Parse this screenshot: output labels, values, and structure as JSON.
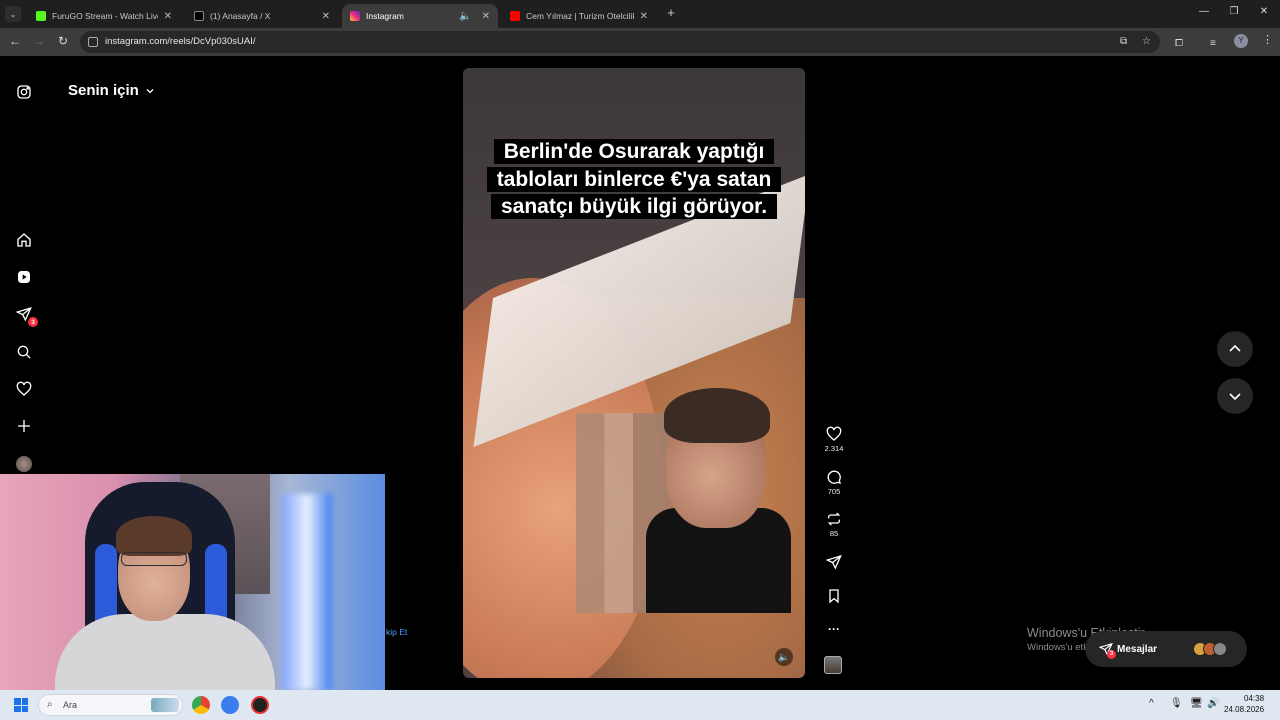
{
  "browser": {
    "tabs": [
      {
        "title": "FuruGO Stream - Watch Live on",
        "favicon_color": "#53fc18",
        "active": false
      },
      {
        "title": "(1) Anasayfa / X",
        "favicon_color": "#000000",
        "active": false
      },
      {
        "title": "Instagram",
        "favicon_color": "#e1306c",
        "active": true
      },
      {
        "title": "Cem Yılmaz | Turizm Otelcilik -",
        "favicon_color": "#ff0000",
        "active": false
      }
    ],
    "url": "instagram.com/reels/DcVp030sUAI/",
    "profile_initial": "Y"
  },
  "instagram": {
    "header": "Senin için",
    "sidebar_badge": "3",
    "reel": {
      "caption": "Berlin'de Osurarak yaptığı tabloları binlerce €'ya satan sanatçı büyük ilgi görüyor.",
      "likes": "2.314",
      "comments": "705",
      "reposts": "85"
    },
    "follow_text": "kip Et",
    "messages": {
      "label": "Mesajlar",
      "badge": "3"
    },
    "activation": {
      "title": "Windows'u Etkinleştir",
      "subtitle": "Windows'u etkinleştirmek için Ayarlar'a gidin."
    }
  },
  "taskbar": {
    "search_placeholder": "Ara",
    "time": "04:38",
    "date": "24.08.2026"
  }
}
